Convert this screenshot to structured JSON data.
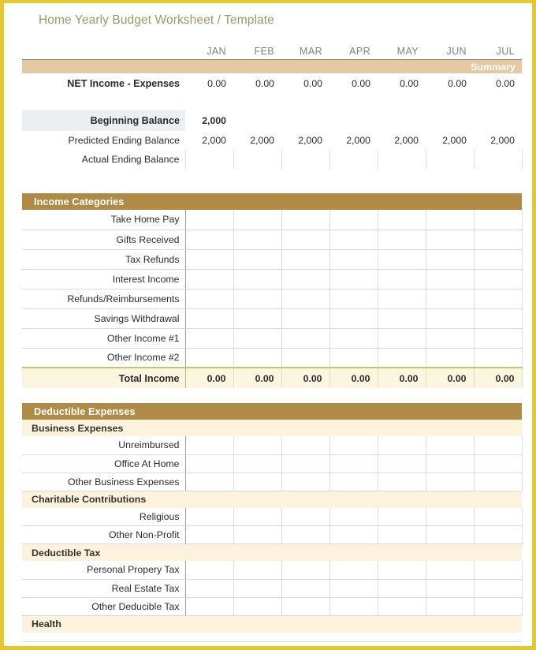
{
  "title": "Home Yearly Budget Worksheet / Template",
  "months": [
    "JAN",
    "FEB",
    "MAR",
    "APR",
    "MAY",
    "JUN",
    "JUL"
  ],
  "colors": {
    "frame": "#e3c92e",
    "title_text": "#9a9a63",
    "summary_bar": "#e4c9a2",
    "section_bar": "#b08b46",
    "subsection_bar": "#fdf3dd",
    "total_row": "#fcf6e0",
    "total_row_border": "#c9c36a",
    "beginning_balance_bg": "#eceff1"
  },
  "summary": {
    "bar_label": "Summary",
    "net_income": {
      "label": "NET Income - Expenses",
      "values": [
        "0.00",
        "0.00",
        "0.00",
        "0.00",
        "0.00",
        "0.00",
        "0.00"
      ]
    },
    "beginning_balance": {
      "label": "Beginning Balance",
      "values": [
        "2,000",
        "",
        "",
        "",
        "",
        "",
        ""
      ]
    },
    "predicted_ending_balance": {
      "label": "Predicted Ending Balance",
      "values": [
        "2,000",
        "2,000",
        "2,000",
        "2,000",
        "2,000",
        "2,000",
        "2,000"
      ]
    },
    "actual_ending_balance": {
      "label": "Actual Ending Balance",
      "values": [
        "",
        "",
        "",
        "",
        "",
        "",
        ""
      ]
    }
  },
  "income": {
    "bar_label": "Income Categories",
    "rows": [
      {
        "label": "Take Home Pay",
        "values": [
          "",
          "",
          "",
          "",
          "",
          "",
          ""
        ]
      },
      {
        "label": "Gifts Received",
        "values": [
          "",
          "",
          "",
          "",
          "",
          "",
          ""
        ]
      },
      {
        "label": "Tax Refunds",
        "values": [
          "",
          "",
          "",
          "",
          "",
          "",
          ""
        ]
      },
      {
        "label": "Interest Income",
        "values": [
          "",
          "",
          "",
          "",
          "",
          "",
          ""
        ]
      },
      {
        "label": "Refunds/Reimbursements",
        "values": [
          "",
          "",
          "",
          "",
          "",
          "",
          ""
        ]
      },
      {
        "label": "Savings Withdrawal",
        "values": [
          "",
          "",
          "",
          "",
          "",
          "",
          ""
        ]
      },
      {
        "label": "Other Income #1",
        "values": [
          "",
          "",
          "",
          "",
          "",
          "",
          ""
        ]
      },
      {
        "label": "Other Income #2",
        "values": [
          "",
          "",
          "",
          "",
          "",
          "",
          ""
        ]
      }
    ],
    "total": {
      "label": "Total Income",
      "values": [
        "0.00",
        "0.00",
        "0.00",
        "0.00",
        "0.00",
        "0.00",
        "0.00"
      ]
    }
  },
  "deductible_expenses": {
    "bar_label": "Deductible Expenses",
    "groups": [
      {
        "heading": "Business Expenses",
        "rows": [
          {
            "label": "Unreimbursed",
            "values": [
              "",
              "",
              "",
              "",
              "",
              "",
              ""
            ]
          },
          {
            "label": "Office At Home",
            "values": [
              "",
              "",
              "",
              "",
              "",
              "",
              ""
            ]
          },
          {
            "label": "Other Business Expenses",
            "values": [
              "",
              "",
              "",
              "",
              "",
              "",
              ""
            ]
          }
        ]
      },
      {
        "heading": "Charitable Contributions",
        "rows": [
          {
            "label": "Religious",
            "values": [
              "",
              "",
              "",
              "",
              "",
              "",
              ""
            ]
          },
          {
            "label": "Other Non-Profit",
            "values": [
              "",
              "",
              "",
              "",
              "",
              "",
              ""
            ]
          }
        ]
      },
      {
        "heading": "Deductible Tax",
        "rows": [
          {
            "label": "Personal Propery Tax",
            "values": [
              "",
              "",
              "",
              "",
              "",
              "",
              ""
            ]
          },
          {
            "label": "Real Estate Tax",
            "values": [
              "",
              "",
              "",
              "",
              "",
              "",
              ""
            ]
          },
          {
            "label": "Other Deducible Tax",
            "values": [
              "",
              "",
              "",
              "",
              "",
              "",
              ""
            ]
          }
        ]
      },
      {
        "heading": "Health",
        "rows": []
      }
    ]
  }
}
